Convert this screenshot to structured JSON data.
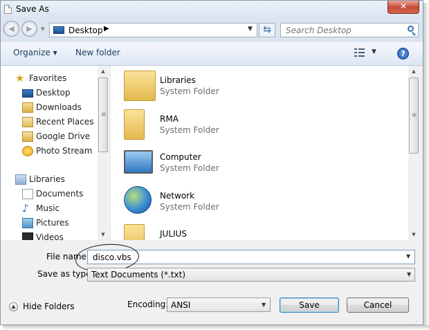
{
  "window": {
    "title": "Save As",
    "close_glyph": "✕"
  },
  "address": {
    "location": "Desktop",
    "separator_glyph": "▶",
    "search_placeholder": "Search Desktop"
  },
  "toolbar": {
    "organize": "Organize ▾",
    "new_folder": "New folder",
    "help_glyph": "?"
  },
  "sidebar": {
    "favorites_header": "Favorites",
    "favorites": [
      {
        "label": "Desktop",
        "icon": "desktop-icon"
      },
      {
        "label": "Downloads",
        "icon": "downloads-icon"
      },
      {
        "label": "Recent Places",
        "icon": "recent-places-icon"
      },
      {
        "label": "Google Drive",
        "icon": "google-drive-icon"
      },
      {
        "label": "Photo Stream",
        "icon": "photo-stream-icon"
      }
    ],
    "libraries_header": "Libraries",
    "libraries": [
      {
        "label": "Documents",
        "icon": "documents-icon"
      },
      {
        "label": "Music",
        "icon": "music-icon"
      },
      {
        "label": "Pictures",
        "icon": "pictures-icon"
      },
      {
        "label": "Videos",
        "icon": "videos-icon"
      }
    ]
  },
  "content": {
    "items": [
      {
        "name": "Libraries",
        "type": "System Folder",
        "icon": "libraries-folder-icon"
      },
      {
        "name": "RMA",
        "type": "System Folder",
        "icon": "user-folder-icon"
      },
      {
        "name": "Computer",
        "type": "System Folder",
        "icon": "computer-icon"
      },
      {
        "name": "Network",
        "type": "System Folder",
        "icon": "network-icon"
      },
      {
        "name": "JULIUS",
        "type": "",
        "icon": "folder-icon"
      }
    ]
  },
  "form": {
    "file_name_label": "File name:",
    "file_name_value": "disco.vbs",
    "save_type_label": "Save as type:",
    "save_type_value": "Text Documents (*.txt)",
    "encoding_label": "Encoding:",
    "encoding_value": "ANSI",
    "hide_folders": "Hide Folders",
    "save_button": "Save",
    "cancel_button": "Cancel"
  },
  "colors": {
    "title_bar": "#dbe5f0",
    "close_button": "#c74a35",
    "save_button_border": "#3c7fb1"
  }
}
